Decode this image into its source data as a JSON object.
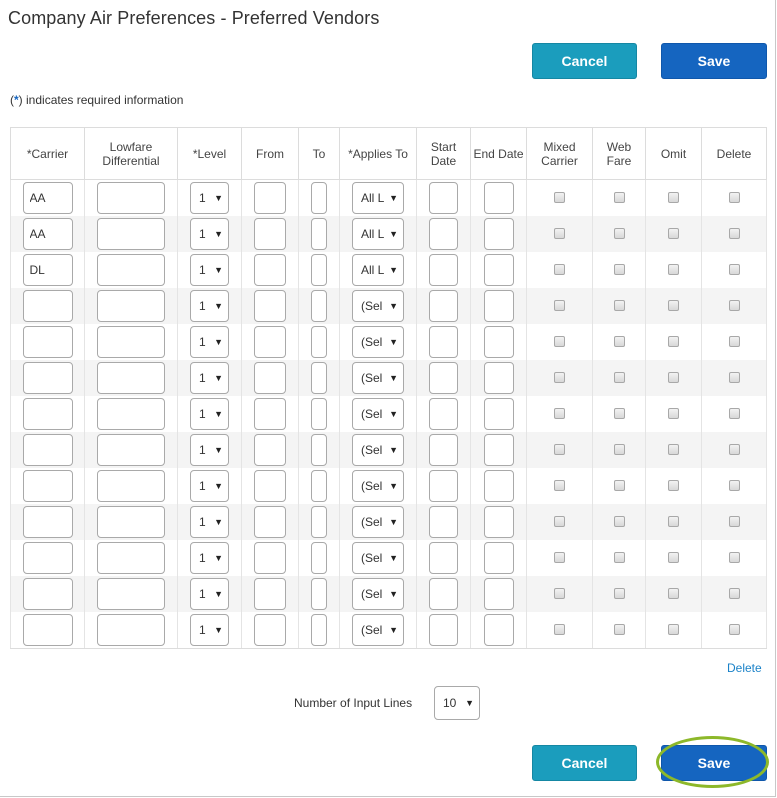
{
  "page": {
    "title": "Company Air Preferences - Preferred Vendors",
    "required_note_star": "*",
    "required_note_text": "indicates required information"
  },
  "buttons": {
    "cancel": "Cancel",
    "save": "Save"
  },
  "table": {
    "headers": {
      "carrier": "*Carrier",
      "lowfare": "Lowfare Differential",
      "level": "*Level",
      "from": "From",
      "to": "To",
      "applies": "*Applies To",
      "start": "Start Date",
      "end": "End Date",
      "mixed": "Mixed Carrier",
      "web": "Web Fare",
      "omit": "Omit",
      "delete": "Delete"
    },
    "rows": [
      {
        "carrier": "AA",
        "level": "1",
        "applies": "All L"
      },
      {
        "carrier": "AA",
        "level": "1",
        "applies": "All L"
      },
      {
        "carrier": "DL",
        "level": "1",
        "applies": "All L"
      },
      {
        "carrier": "",
        "level": "1",
        "applies": "(Sel"
      },
      {
        "carrier": "",
        "level": "1",
        "applies": "(Sel"
      },
      {
        "carrier": "",
        "level": "1",
        "applies": "(Sel"
      },
      {
        "carrier": "",
        "level": "1",
        "applies": "(Sel"
      },
      {
        "carrier": "",
        "level": "1",
        "applies": "(Sel"
      },
      {
        "carrier": "",
        "level": "1",
        "applies": "(Sel"
      },
      {
        "carrier": "",
        "level": "1",
        "applies": "(Sel"
      },
      {
        "carrier": "",
        "level": "1",
        "applies": "(Sel"
      },
      {
        "carrier": "",
        "level": "1",
        "applies": "(Sel"
      },
      {
        "carrier": "",
        "level": "1",
        "applies": "(Sel"
      }
    ]
  },
  "footer": {
    "delete_link": "Delete",
    "input_lines_label": "Number of Input Lines",
    "input_lines_value": "10"
  },
  "icons": {
    "dropdown": "caret-down-icon"
  },
  "colors": {
    "cancel_button": "#1b9dbd",
    "save_button": "#1565c0",
    "link": "#1a82c8",
    "highlight_ring": "#8db82a"
  }
}
